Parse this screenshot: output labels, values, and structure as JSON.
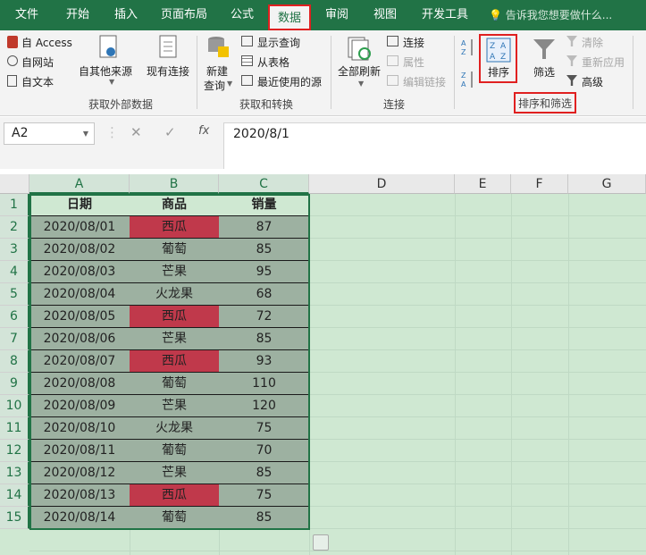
{
  "tabs": [
    {
      "label": "文件",
      "active": false
    },
    {
      "label": "开始",
      "active": false
    },
    {
      "label": "插入",
      "active": false
    },
    {
      "label": "页面布局",
      "active": false
    },
    {
      "label": "公式",
      "active": false
    },
    {
      "label": "数据",
      "active": true
    },
    {
      "label": "审阅",
      "active": false
    },
    {
      "label": "视图",
      "active": false
    },
    {
      "label": "开发工具",
      "active": false
    }
  ],
  "tell_me": "告诉我您想要做什么...",
  "ribbon": {
    "get_external": {
      "access": "自 Access",
      "web": "自网站",
      "text": "自文本",
      "other": "自其他来源",
      "existing": "现有连接",
      "group_label": "获取外部数据"
    },
    "transform": {
      "new_query_1": "新建",
      "new_query_2": "查询",
      "show_queries": "显示查询",
      "from_table": "从表格",
      "recent_sources": "最近使用的源",
      "group_label": "获取和转换"
    },
    "connections": {
      "refresh_all": "全部刷新",
      "connections": "连接",
      "properties": "属性",
      "edit_links": "编辑链接",
      "group_label": "连接"
    },
    "sort_filter": {
      "sort": "排序",
      "filter": "筛选",
      "clear": "清除",
      "reapply": "重新应用",
      "advanced": "高级",
      "group_label": "排序和筛选"
    }
  },
  "formula_bar": {
    "name_box": "A2",
    "cancel": "✕",
    "enter": "✓",
    "fx": "fx",
    "value": "2020/8/1"
  },
  "columns": [
    "A",
    "B",
    "C",
    "D",
    "E",
    "F",
    "G"
  ],
  "rows": [
    "1",
    "2",
    "3",
    "4",
    "5",
    "6",
    "7",
    "8",
    "9",
    "10",
    "11",
    "12",
    "13",
    "14",
    "15"
  ],
  "table": {
    "headers": [
      "日期",
      "商品",
      "销量"
    ],
    "data": [
      {
        "date": "2020/08/01",
        "product": "西瓜",
        "sales": "87",
        "highlight": true
      },
      {
        "date": "2020/08/02",
        "product": "葡萄",
        "sales": "85",
        "highlight": false
      },
      {
        "date": "2020/08/03",
        "product": "芒果",
        "sales": "95",
        "highlight": false
      },
      {
        "date": "2020/08/04",
        "product": "火龙果",
        "sales": "68",
        "highlight": false
      },
      {
        "date": "2020/08/05",
        "product": "西瓜",
        "sales": "72",
        "highlight": true
      },
      {
        "date": "2020/08/06",
        "product": "芒果",
        "sales": "85",
        "highlight": false
      },
      {
        "date": "2020/08/07",
        "product": "西瓜",
        "sales": "93",
        "highlight": true
      },
      {
        "date": "2020/08/08",
        "product": "葡萄",
        "sales": "110",
        "highlight": false
      },
      {
        "date": "2020/08/09",
        "product": "芒果",
        "sales": "120",
        "highlight": false
      },
      {
        "date": "2020/08/10",
        "product": "火龙果",
        "sales": "75",
        "highlight": false
      },
      {
        "date": "2020/08/11",
        "product": "葡萄",
        "sales": "70",
        "highlight": false
      },
      {
        "date": "2020/08/12",
        "product": "芒果",
        "sales": "85",
        "highlight": false
      },
      {
        "date": "2020/08/13",
        "product": "西瓜",
        "sales": "75",
        "highlight": true
      },
      {
        "date": "2020/08/14",
        "product": "葡萄",
        "sales": "85",
        "highlight": false
      }
    ]
  },
  "colors": {
    "brand": "#217346",
    "highlight_red": "#c0394b",
    "selection_fill": "#9db1a1",
    "annotation_red": "#e02020"
  }
}
